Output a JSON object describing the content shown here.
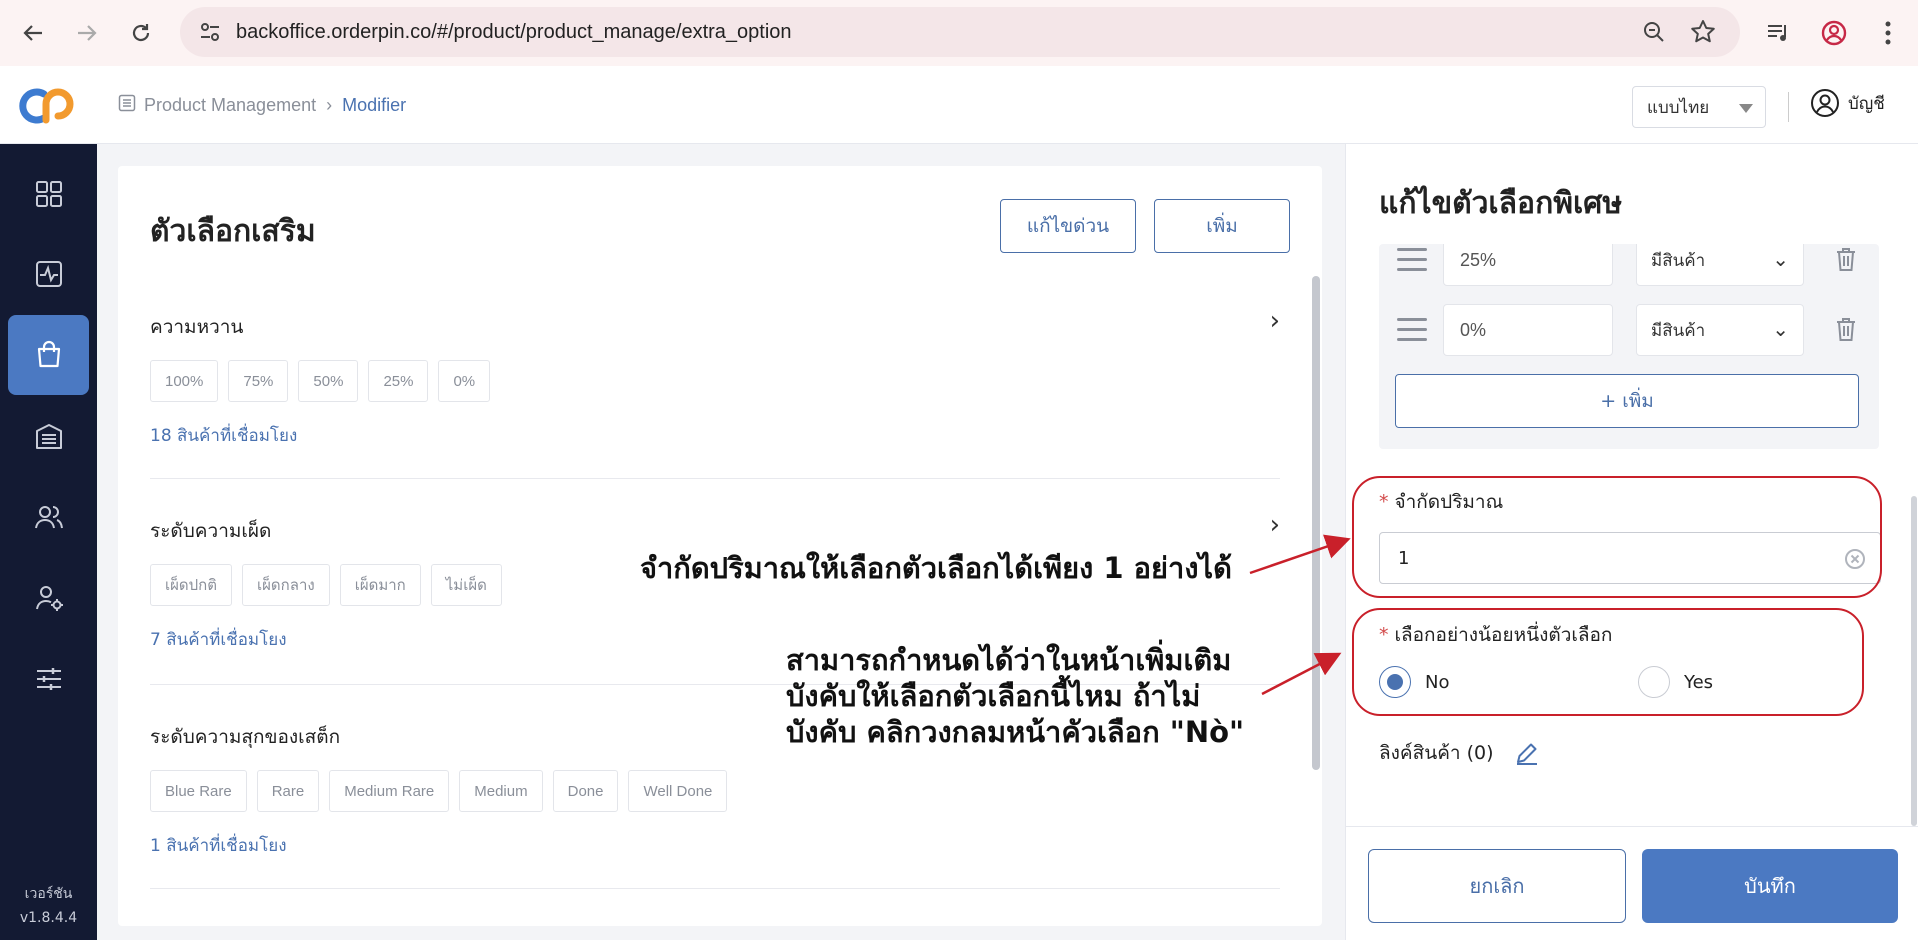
{
  "browser": {
    "url": "backoffice.orderpin.co/#/product/product_manage/extra_option"
  },
  "header": {
    "breadcrumb_parent": "Product Management",
    "breadcrumb_current": "Modifier",
    "language": "แบบไทย",
    "account_label": "บัญชี"
  },
  "sidebar": {
    "version_label": "เวอร์ชัน",
    "version": "v1.8.4.4"
  },
  "main": {
    "title": "ตัวเลือกเสริม",
    "quick_edit_label": "แก้ไขด่วน",
    "add_label": "เพิ่ม",
    "groups": [
      {
        "title": "ความหวาน",
        "chips": [
          "100%",
          "75%",
          "50%",
          "25%",
          "0%"
        ],
        "link": "18 สินค้าที่เชื่อมโยง"
      },
      {
        "title": "ระดับความเผ็ด",
        "chips": [
          "เผ็ดปกติ",
          "เผ็ดกลาง",
          "เผ็ดมาก",
          "ไม่เผ็ด"
        ],
        "link": "7 สินค้าที่เชื่อมโยง"
      },
      {
        "title": "ระดับความสุกของเสต็ก",
        "chips": [
          "Blue Rare",
          "Rare",
          "Medium Rare",
          "Medium",
          "Done",
          "Well Done"
        ],
        "link": "1 สินค้าที่เชื่อมโยง"
      }
    ]
  },
  "panel": {
    "title": "แก้ไขตัวเลือกพิเศษ",
    "options": [
      {
        "name": "25%",
        "status": "มีสินค้า"
      },
      {
        "name": "0%",
        "status": "มีสินค้า"
      }
    ],
    "add_option_label": "+ เพิ่ม",
    "limit_label": "จำกัดปริมาณ",
    "limit_value": "1",
    "required_label": "เลือกอย่างน้อยหนึ่งตัวเลือก",
    "radio_no": "No",
    "radio_yes": "Yes",
    "required_selected": "No",
    "link_products_label": "ลิงค์สินค้า (0)",
    "cancel_label": "ยกเลิก",
    "save_label": "บันทึก"
  },
  "annotations": {
    "limit_note": "จำกัดปริมาณให้เลือกตัวเลือกได้เพียง 1 อย่างได้",
    "required_note_line1": "สามารถกำหนดได้ว่าในหน้าเพิ่มเติม",
    "required_note_line2": "บังคับให้เลือกตัวเลือกนี้ไหม ถ้าไม่",
    "required_note_line3": "บังคับ คลิกวงกลมหน้าคัวเลือก \"Nò\""
  },
  "colors": {
    "accent": "#4b79c2",
    "sidebar_bg": "#131a33",
    "annotation_red": "#c9202a"
  }
}
